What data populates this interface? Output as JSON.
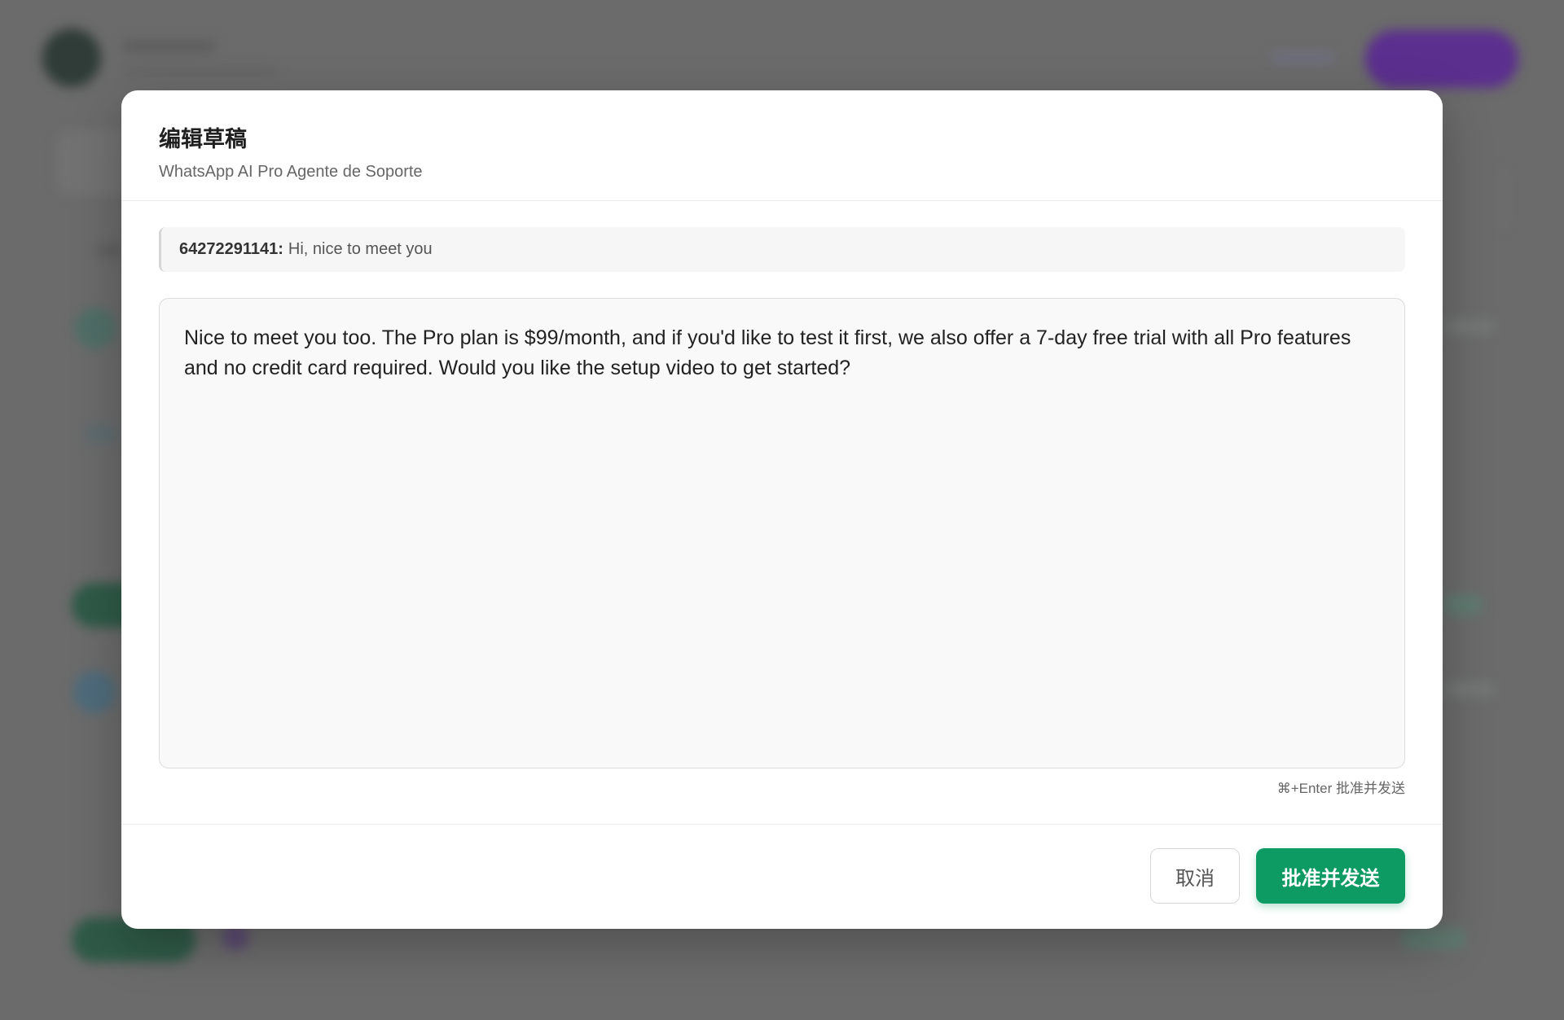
{
  "modal": {
    "title": "编辑草稿",
    "subtitle": "WhatsApp AI Pro Agente de Soporte",
    "quote": {
      "sender": "64272291141:",
      "text": "Hi, nice to meet you"
    },
    "draft": {
      "value": "Nice to meet you too. The Pro plan is $99/month, and if you'd like to test it first, we also offer a 7-day free trial with all Pro features and no credit card required. Would you like the setup video to get started?"
    },
    "shortcut_hint": "⌘+Enter 批准并发送",
    "cancel_label": "取消",
    "approve_label": "批准并发送"
  },
  "colors": {
    "overlay": "#6b6b6b",
    "accent_green": "#0e9b63",
    "backdrop_purple_button": "#5b2f8e"
  }
}
